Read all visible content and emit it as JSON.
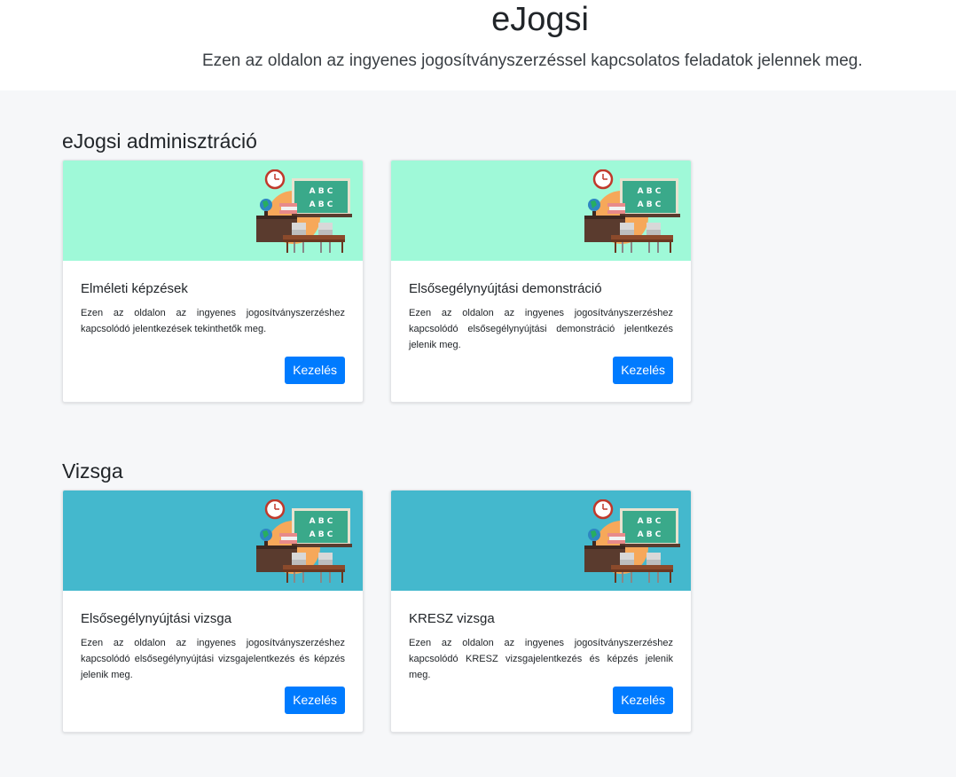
{
  "header": {
    "title": "eJogsi",
    "subtitle": "Ezen az oldalon az ingyenes jogosítványszerzéssel kapcsolatos feladatok jelennek meg."
  },
  "sections": [
    {
      "title": "eJogsi adminisztráció",
      "banner_color": "#9ff9d8",
      "cards": [
        {
          "title": "Elméleti képzések",
          "text": "Ezen az oldalon az ingyenes jogosítványszerzéshez kapcsolódó jelentkezések tekinthetők meg.",
          "button": "Kezelés"
        },
        {
          "title": "Elsősegélynyújtási demonstráció",
          "text": "Ezen az oldalon az ingyenes jogosítványszerzéshez kapcsolódó elsősegélynyújtási demonstráció jelentkezés jelenik meg.",
          "button": "Kezelés"
        }
      ]
    },
    {
      "title": "Vizsga",
      "banner_color": "#44b8cd",
      "cards": [
        {
          "title": "Elsősegélynyújtási vizsga",
          "text": "Ezen az oldalon az ingyenes jogosítványszerzéshez kapcsolódó elsősegélynyújtási vizsgajelentkezés és képzés jelenik meg.",
          "button": "Kezelés"
        },
        {
          "title": "KRESZ vizsga",
          "text": "Ezen az oldalon az ingyenes jogosítványszerzéshez kapcsolódó KRESZ vizsgajelentkezés és képzés jelenik meg.",
          "button": "Kezelés"
        }
      ]
    }
  ],
  "illustration": {
    "icon": "classroom-illustration",
    "board_text_line1": "A B C",
    "board_text_line2": "A B C"
  },
  "colors": {
    "button": "#007bff",
    "page_bg": "#f6f7f9"
  }
}
